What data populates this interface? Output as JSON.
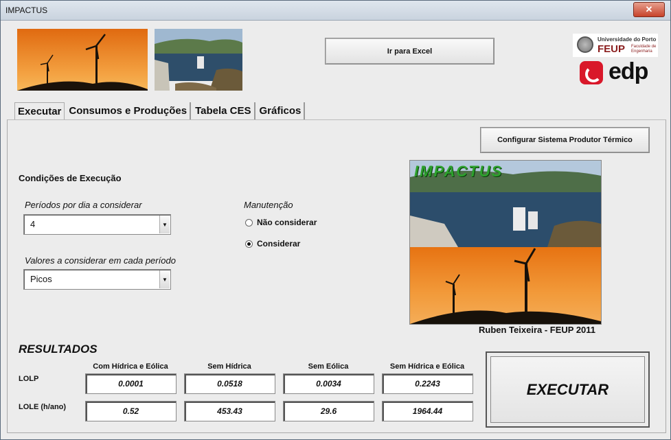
{
  "window": {
    "title": "IMPACTUS",
    "close_label": "✕"
  },
  "buttons": {
    "excel": "Ir para Excel",
    "config": "Configurar Sistema Produtor Térmico",
    "executar": "EXECUTAR"
  },
  "logos": {
    "up_line1": "Universidade do Porto",
    "feup": "FEUP",
    "feup_sub1": "Faculdade de",
    "feup_sub2": "Engenharia",
    "edp": "edp"
  },
  "tabs": [
    "Executar",
    "Consumos e Produções",
    "Tabela CES",
    "Gráficos"
  ],
  "conditions": {
    "heading": "Condições de Execução",
    "periods_label": "Períodos por dia a considerar",
    "periods_value": "4",
    "values_label": "Valores a considerar em cada período",
    "values_value": "Picos",
    "maint_label": "Manutenção",
    "maint_options": [
      {
        "label": "Não considerar",
        "selected": false
      },
      {
        "label": "Considerar",
        "selected": true
      }
    ]
  },
  "splash": {
    "logo_text": "IMPACTUS",
    "credit": "Ruben Teixeira - FEUP 2011"
  },
  "results": {
    "heading": "RESULTADOS",
    "columns": [
      "Com Hídrica e Eólica",
      "Sem Hídrica",
      "Sem Eólica",
      "Sem Hídrica e Eólica"
    ],
    "rows": [
      {
        "label": "LOLP",
        "values": [
          "0.0001",
          "0.0518",
          "0.0034",
          "0.2243"
        ]
      },
      {
        "label": "LOLE (h/ano)",
        "values": [
          "0.52",
          "453.43",
          "29.6",
          "1964.44"
        ]
      }
    ]
  }
}
